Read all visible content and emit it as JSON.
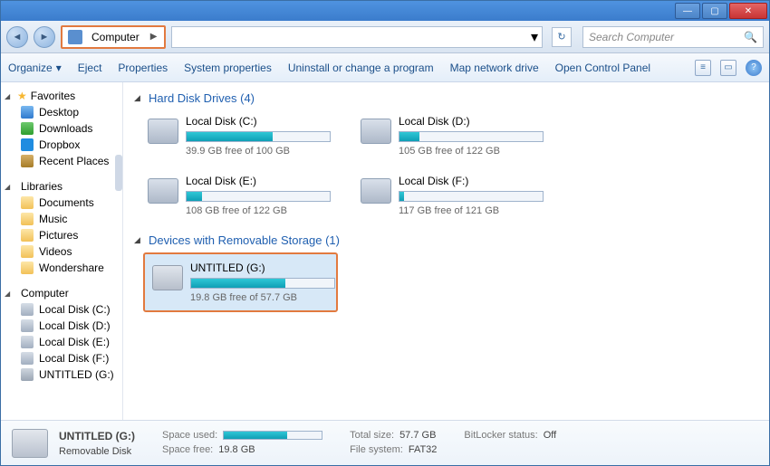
{
  "titlebar": {
    "min": "—",
    "max": "▢",
    "close": "✕"
  },
  "nav": {
    "location": "Computer",
    "dropdown_glyph": "▾",
    "refresh_glyph": "↻",
    "search_placeholder": "Search Computer",
    "search_glyph": "🔍"
  },
  "toolbar": {
    "organize": "Organize",
    "organize_caret": "▾",
    "eject": "Eject",
    "properties": "Properties",
    "system_properties": "System properties",
    "uninstall": "Uninstall or change a program",
    "map_drive": "Map network drive",
    "control_panel": "Open Control Panel",
    "help_glyph": "?"
  },
  "sidebar": {
    "favorites": {
      "label": "Favorites",
      "items": [
        {
          "label": "Desktop"
        },
        {
          "label": "Downloads"
        },
        {
          "label": "Dropbox"
        },
        {
          "label": "Recent Places"
        }
      ]
    },
    "libraries": {
      "label": "Libraries",
      "items": [
        {
          "label": "Documents"
        },
        {
          "label": "Music"
        },
        {
          "label": "Pictures"
        },
        {
          "label": "Videos"
        },
        {
          "label": "Wondershare"
        }
      ]
    },
    "computer": {
      "label": "Computer",
      "items": [
        {
          "label": "Local Disk (C:)"
        },
        {
          "label": "Local Disk (D:)"
        },
        {
          "label": "Local Disk (E:)"
        },
        {
          "label": "Local Disk (F:)"
        },
        {
          "label": "UNTITLED (G:)"
        }
      ]
    }
  },
  "content": {
    "hdd_header": "Hard Disk Drives (4)",
    "removable_header": "Devices with Removable Storage (1)",
    "hdd": [
      {
        "name": "Local Disk (C:)",
        "free": "39.9 GB free of 100 GB",
        "pct": 60
      },
      {
        "name": "Local Disk (D:)",
        "free": "105 GB free of 122 GB",
        "pct": 14
      },
      {
        "name": "Local Disk (E:)",
        "free": "108 GB free of 122 GB",
        "pct": 11
      },
      {
        "name": "Local Disk (F:)",
        "free": "117 GB free of 121 GB",
        "pct": 3
      }
    ],
    "removable": [
      {
        "name": "UNTITLED (G:)",
        "free": "19.8 GB free of 57.7 GB",
        "pct": 66
      }
    ]
  },
  "status": {
    "name": "UNTITLED (G:)",
    "type": "Removable Disk",
    "space_used_label": "Space used:",
    "space_free_label": "Space free:",
    "space_free": "19.8 GB",
    "total_size_label": "Total size:",
    "total_size": "57.7 GB",
    "file_system_label": "File system:",
    "file_system": "FAT32",
    "bitlocker_label": "BitLocker status:",
    "bitlocker": "Off"
  }
}
